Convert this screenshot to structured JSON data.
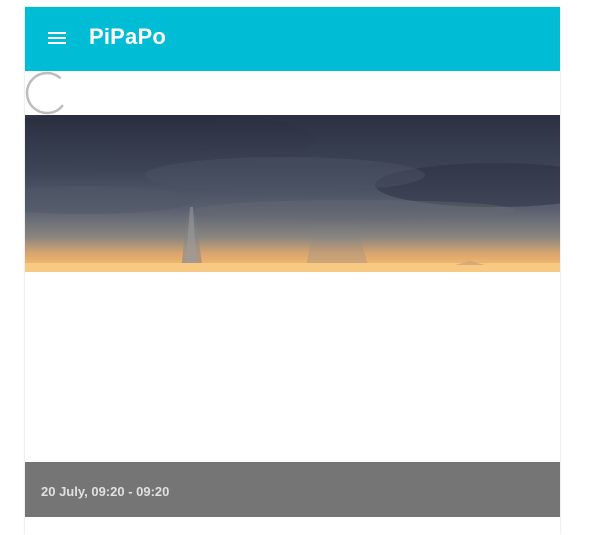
{
  "toolbar": {
    "app_title": "PiPaPo",
    "menu_icon": "menu-icon",
    "background_color": "#00bcd4"
  },
  "loading": {
    "spinner_icon": "loading-spinner-icon"
  },
  "event_card": {
    "image": "storm-clouds-sunset-photo",
    "datetime": "20 July, 09:20 - 09:20",
    "caption_background": "#757575"
  }
}
